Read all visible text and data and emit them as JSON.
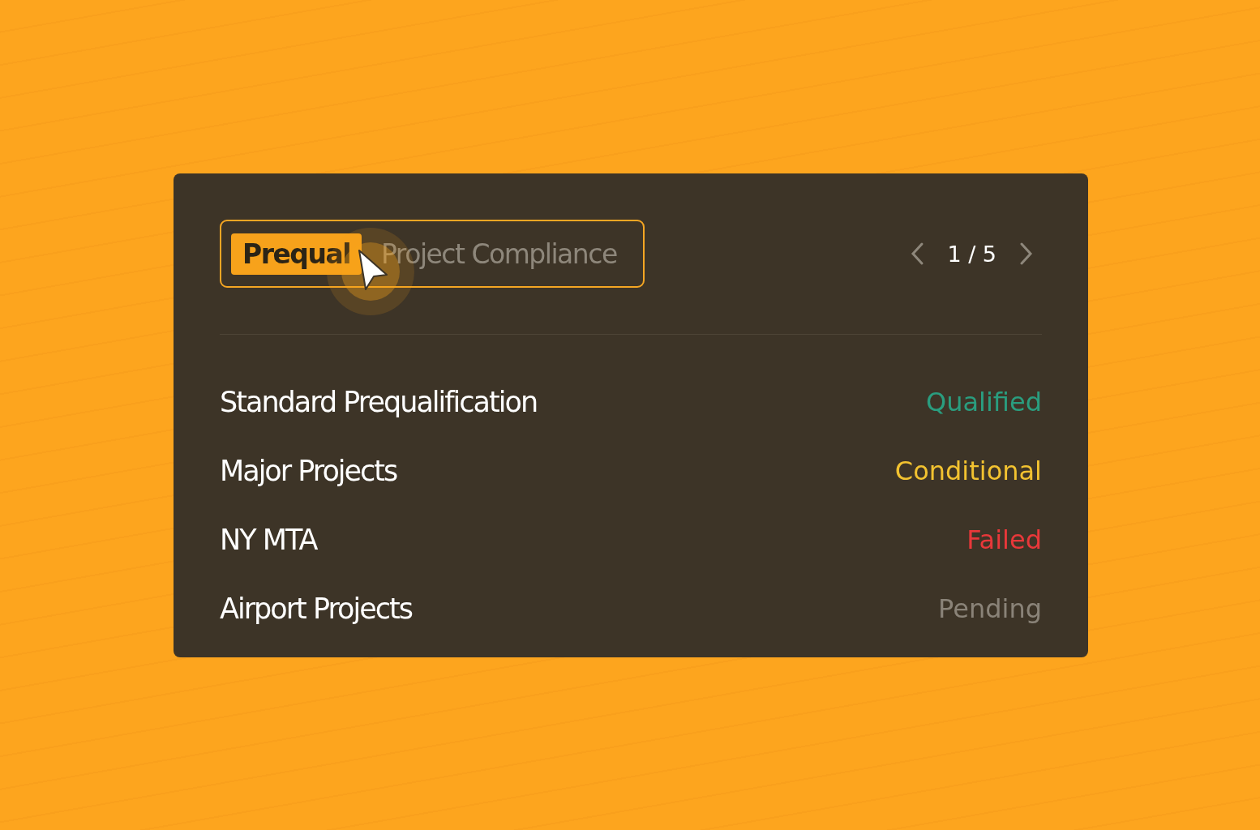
{
  "tabs": [
    {
      "label": "Prequal",
      "selected": true
    },
    {
      "label": "Project Compliance",
      "selected": false
    }
  ],
  "pager": {
    "text": "1 / 5"
  },
  "rows": [
    {
      "name": "Standard Prequalification",
      "status": "Qualified",
      "color": "#2a9d7f"
    },
    {
      "name": "Major Projects",
      "status": "Conditional",
      "color": "#f2c230"
    },
    {
      "name": "NY MTA",
      "status": "Failed",
      "color": "#e8383a"
    },
    {
      "name": "Airport Projects",
      "status": "Pending",
      "color": "#8a8378"
    }
  ]
}
